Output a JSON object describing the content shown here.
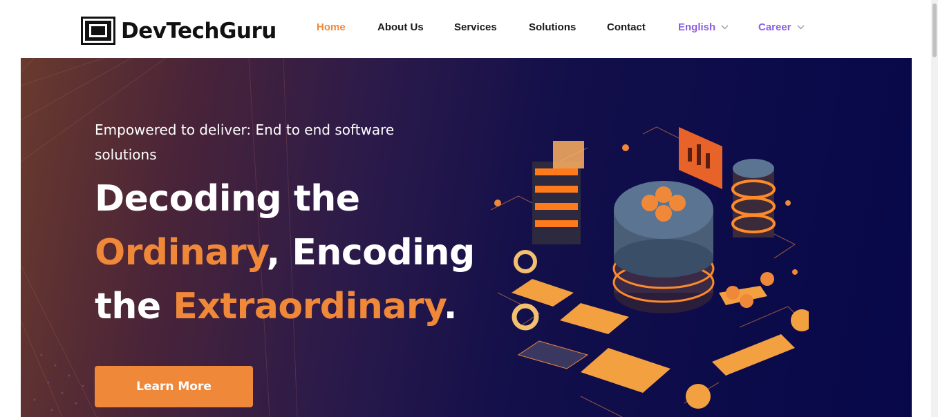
{
  "brand": {
    "name": "DevTechGuru",
    "logo_icon": "monitor-icon"
  },
  "nav": {
    "items": [
      {
        "label": "Home",
        "active": true
      },
      {
        "label": "About Us"
      },
      {
        "label": "Services"
      },
      {
        "label": "Solutions"
      },
      {
        "label": "Contact"
      },
      {
        "label": "English",
        "dropdown": true
      },
      {
        "label": "Career",
        "dropdown": true
      }
    ]
  },
  "hero": {
    "subtitle": "Empowered to deliver: End to end software solutions",
    "headline": {
      "line1": "Decoding the",
      "highlight1": "Ordinary",
      "mid": ", Encoding",
      "line3a": "the ",
      "highlight2": "Extraordinary",
      "end": "."
    },
    "cta_label": "Learn More",
    "illustration": "isometric-data-server-icon"
  },
  "colors": {
    "accent": "#f0883a",
    "dropdown": "#8c5fe0",
    "hero_dark": "#07084a"
  }
}
